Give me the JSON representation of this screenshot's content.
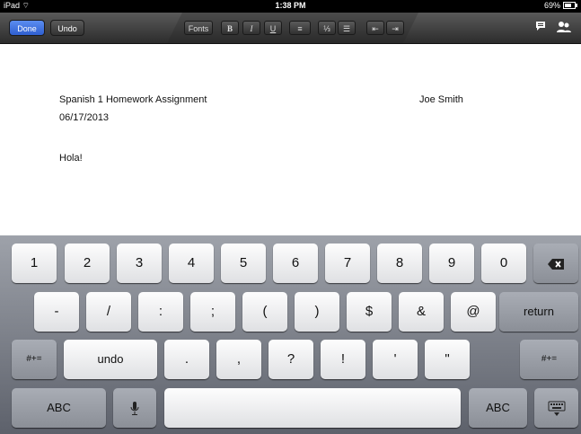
{
  "status": {
    "device": "iPad",
    "time": "1:38 PM",
    "battery": "69%",
    "battery_level": 0.69
  },
  "toolbar": {
    "done": "Done",
    "undo": "Undo",
    "fonts": "Fonts",
    "bold": "B",
    "italic": "I",
    "underline": "U",
    "align": "≡",
    "numbered_list": "⅓",
    "bulleted_list": "☰",
    "outdent": "⇤",
    "indent": "⇥"
  },
  "document": {
    "title": "Spanish 1 Homework Assignment",
    "author": "Joe Smith",
    "date": "06/17/2013",
    "body": "Hola!"
  },
  "keyboard": {
    "row1": [
      "1",
      "2",
      "3",
      "4",
      "5",
      "6",
      "7",
      "8",
      "9",
      "0"
    ],
    "row2": [
      "-",
      "/",
      ":",
      ";",
      "(",
      ")",
      "$",
      "&",
      "@"
    ],
    "return_label": "return",
    "row3_left": "#+=",
    "undo_label": "undo",
    "row3": [
      ".",
      ",",
      "?",
      "!",
      "'",
      "\""
    ],
    "row3_right": "#+=",
    "abc_left": "ABC",
    "abc_right": "ABC"
  }
}
